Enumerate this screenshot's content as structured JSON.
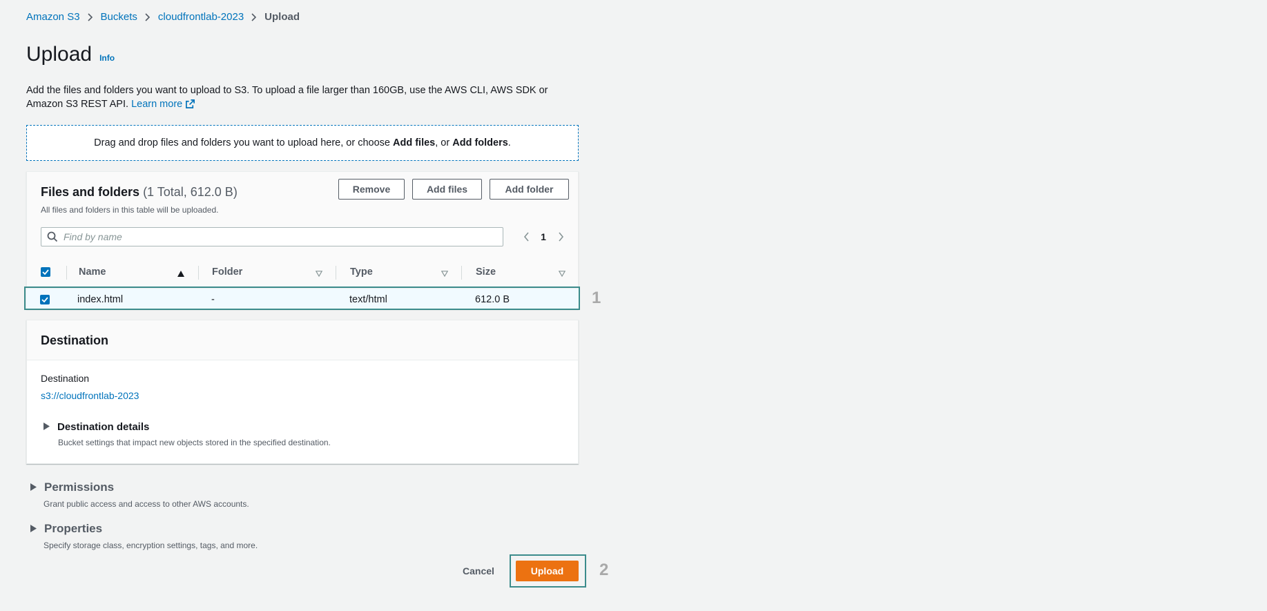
{
  "breadcrumb": {
    "items": [
      "Amazon S3",
      "Buckets",
      "cloudfrontlab-2023"
    ],
    "current": "Upload"
  },
  "header": {
    "title": "Upload",
    "info": "Info",
    "description": "Add the files and folders you want to upload to S3. To upload a file larger than 160GB, use the AWS CLI, AWS SDK or Amazon S3 REST API.",
    "learn_more": "Learn more"
  },
  "dropzone": {
    "text_before": "Drag and drop files and folders you want to upload here, or choose ",
    "add_files": "Add files",
    "text_mid": ", or ",
    "add_folders": "Add folders",
    "text_after": "."
  },
  "files_panel": {
    "title": "Files and folders",
    "count": "(1 Total, 612.0 B)",
    "subtitle": "All files and folders in this table will be uploaded.",
    "remove_label": "Remove",
    "add_files_label": "Add files",
    "add_folder_label": "Add folder",
    "search_placeholder": "Find by name",
    "page": "1",
    "columns": [
      "Name",
      "Folder",
      "Type",
      "Size"
    ],
    "rows": [
      {
        "name": "index.html",
        "folder": "-",
        "type": "text/html",
        "size": "612.0 B"
      }
    ]
  },
  "destination": {
    "title": "Destination",
    "label": "Destination",
    "link": "s3://cloudfrontlab-2023",
    "details_title": "Destination details",
    "details_desc": "Bucket settings that impact new objects stored in the specified destination."
  },
  "permissions": {
    "title": "Permissions",
    "desc": "Grant public access and access to other AWS accounts."
  },
  "properties": {
    "title": "Properties",
    "desc": "Specify storage class, encryption settings, tags, and more."
  },
  "actions": {
    "cancel": "Cancel",
    "upload": "Upload"
  },
  "annotations": {
    "step1": "1",
    "step2": "2"
  },
  "colors": {
    "link": "#0073bb",
    "primary": "#ec7211",
    "highlight": "#3b8b8b"
  }
}
